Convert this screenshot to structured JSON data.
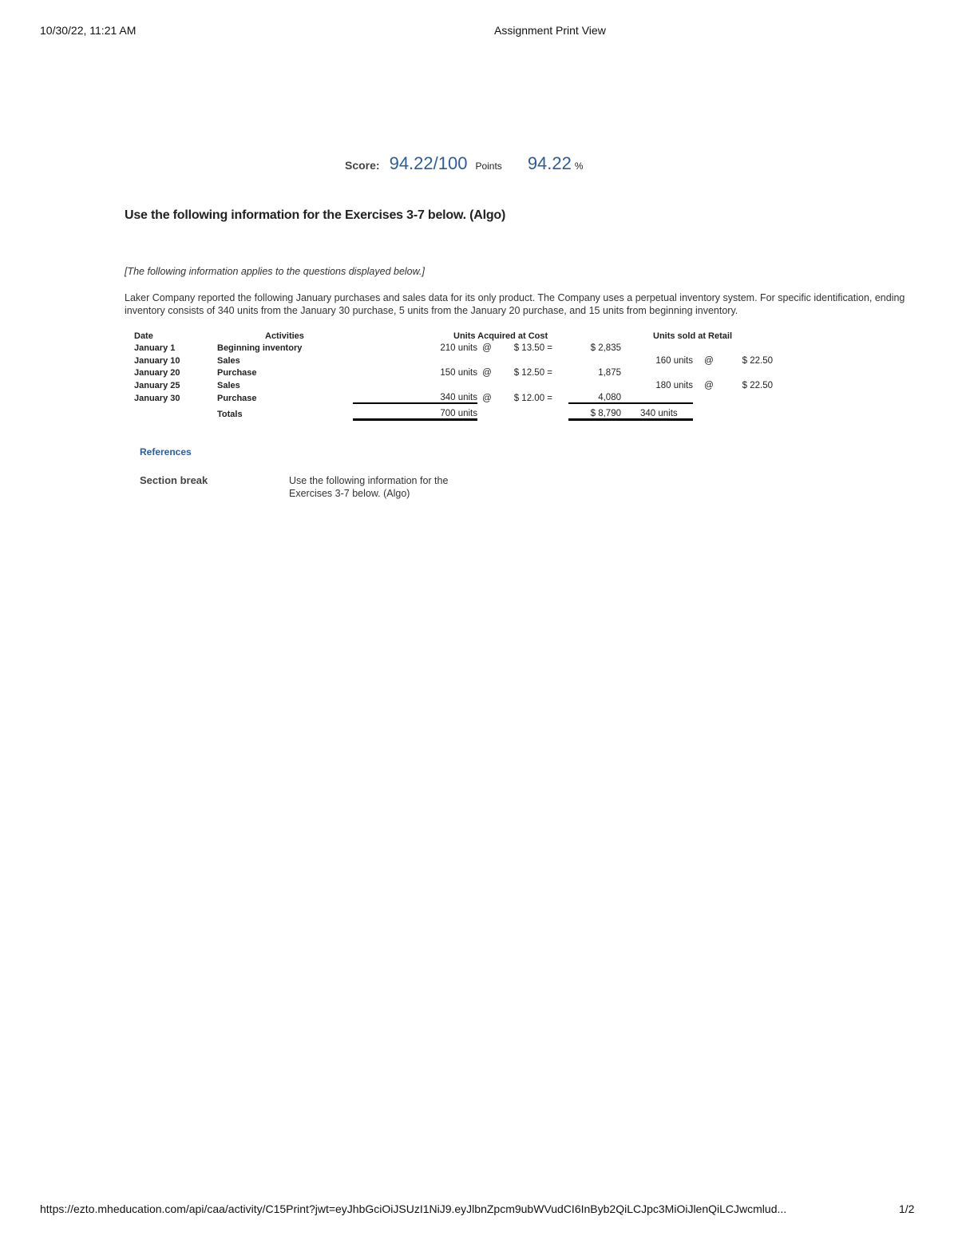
{
  "header": {
    "datetime": "10/30/22, 11:21 AM",
    "page_title": "Assignment Print View"
  },
  "score": {
    "label": "Score:",
    "points_value": "94.22/100",
    "points_unit": "Points",
    "percent_value": "94.22",
    "percent_unit": "%"
  },
  "section_title": "Use the following information for the Exercises 3-7 below. (Algo)",
  "intro_note": "[The following information applies to the questions displayed below.]",
  "paragraph": "Laker Company reported the following January purchases and sales data for its only product. The Company uses a perpetual inventory system. For specific identification, ending inventory consists of 340 units from the January 30 purchase, 5 units from the January 20 purchase, and 15 units from beginning inventory.",
  "table": {
    "headers": {
      "date": "Date",
      "activities": "Activities",
      "acquired": "Units Acquired at Cost",
      "sold": "Units sold at Retail"
    },
    "rows": [
      {
        "date": "January 1",
        "activity": "Beginning inventory",
        "acq_units": "210 units",
        "acq_at": "@",
        "acq_cost": "$ 13.50 =",
        "acq_total": "$ 2,835",
        "sold_units": "",
        "sold_at": "",
        "sold_price": ""
      },
      {
        "date": "January 10",
        "activity": "Sales",
        "acq_units": "",
        "acq_at": "",
        "acq_cost": "",
        "acq_total": "",
        "sold_units": "160 units",
        "sold_at": "@",
        "sold_price": "$ 22.50"
      },
      {
        "date": "January 20",
        "activity": "Purchase",
        "acq_units": "150 units",
        "acq_at": "@",
        "acq_cost": "$ 12.50 =",
        "acq_total": "1,875",
        "sold_units": "",
        "sold_at": "",
        "sold_price": ""
      },
      {
        "date": "January 25",
        "activity": "Sales",
        "acq_units": "",
        "acq_at": "",
        "acq_cost": "",
        "acq_total": "",
        "sold_units": "180 units",
        "sold_at": "@",
        "sold_price": "$ 22.50"
      },
      {
        "date": "January 30",
        "activity": "Purchase",
        "acq_units": "340 units",
        "acq_at": "@",
        "acq_cost": "$ 12.00 =",
        "acq_total": "4,080",
        "sold_units": "",
        "sold_at": "",
        "sold_price": ""
      }
    ],
    "totals": {
      "label": "Totals",
      "acq_units": "700 units",
      "acq_total": "$ 8,790",
      "sold_units": "340 units"
    }
  },
  "references": {
    "heading": "References",
    "section_label": "Section break",
    "section_text": "Use the following information for the Exercises 3-7 below. (Algo)"
  },
  "footer": {
    "url": "https://ezto.mheducation.com/api/caa/activity/C15Print?jwt=eyJhbGciOiJSUzI1NiJ9.eyJlbnZpcm9ubWVudCI6InByb2QiLCJpc3MiOiJlenQiLCJwcmlud...",
    "page": "1/2"
  },
  "colors": {
    "accent_blue": "#2d5d99"
  }
}
